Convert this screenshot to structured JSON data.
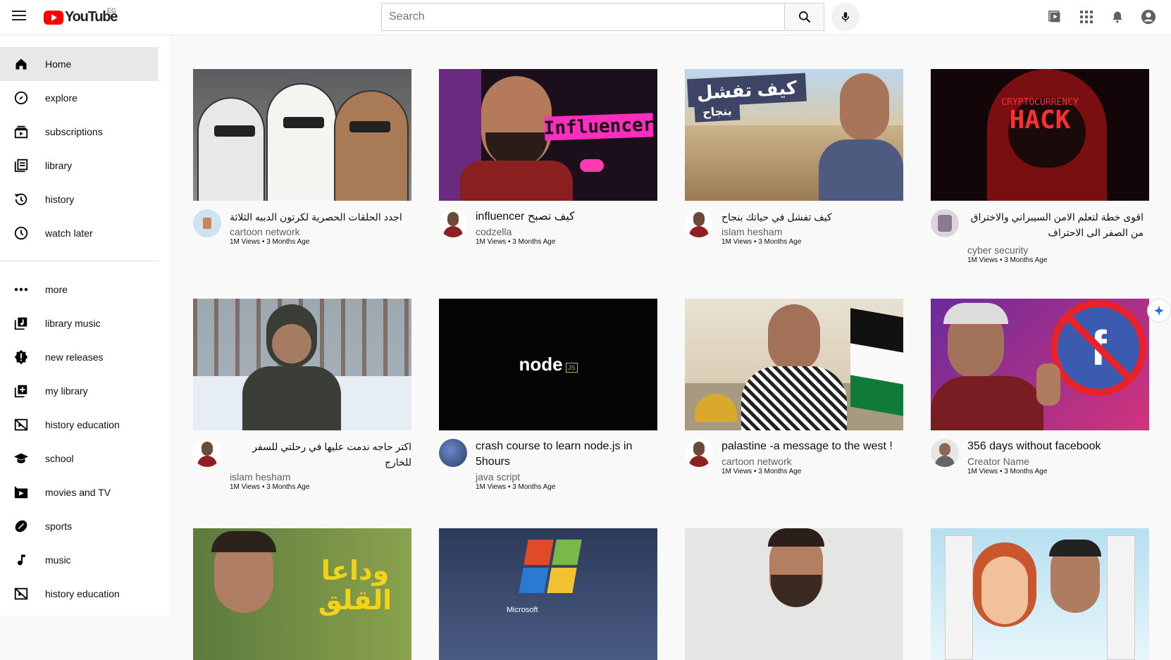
{
  "header": {
    "logo_text": "YouTube",
    "country_code": "EG",
    "search_placeholder": "Search"
  },
  "sidebar": {
    "items": [
      {
        "label": "Home",
        "icon": "home-icon"
      },
      {
        "label": "explore",
        "icon": "compass-icon"
      },
      {
        "label": "subscriptions",
        "icon": "subscriptions-icon"
      },
      {
        "label": "library",
        "icon": "library-icon"
      },
      {
        "label": "history",
        "icon": "history-icon"
      },
      {
        "label": "watch later",
        "icon": "clock-icon"
      },
      {
        "label": "more",
        "icon": "more-dots-icon"
      },
      {
        "label": "library music",
        "icon": "music-library-icon"
      },
      {
        "label": "new releases",
        "icon": "new-releases-icon"
      },
      {
        "label": "my library",
        "icon": "add-library-icon"
      },
      {
        "label": "history education",
        "icon": "education-icon"
      },
      {
        "label": "school",
        "icon": "school-icon"
      },
      {
        "label": "movies and TV",
        "icon": "movies-icon"
      },
      {
        "label": "sports",
        "icon": "sports-icon"
      },
      {
        "label": "music",
        "icon": "music-note-icon"
      },
      {
        "label": "history education",
        "icon": "education-icon"
      }
    ]
  },
  "videos": [
    {
      "title": "اجدد الحلقات الحصرية لكرتون الدببه الثلاثة",
      "channel": "cartoon network",
      "stats": "1M Views • 3 Months Age",
      "rtl": true
    },
    {
      "title": "كيف تصبح influencer",
      "channel": "codzella",
      "stats": "1M Views • 3 Months Age",
      "rtl": true
    },
    {
      "title": "كيف تفشل في حياتك بنجاح",
      "channel": "islam hesham",
      "stats": "1M Views • 3 Months Age",
      "rtl": true
    },
    {
      "title": "اقوى خطة لتعلم الامن السيبراني والاختراق من الصفر الى الاحتراف",
      "channel": "cyber security",
      "stats": "1M Views • 3 Months Age",
      "rtl": true
    },
    {
      "title": "اكتر حاجه ندمت عليها في رحلتي للسفر للخارج",
      "channel": "islam hesham",
      "stats": "1M Views • 3 Months Age",
      "rtl": true
    },
    {
      "title": "crash course to learn node.js in 5hours",
      "channel": "java script",
      "stats": "1M Views • 3 Months Age",
      "rtl": false
    },
    {
      "title": "palastine -a message to the west !",
      "channel": "cartoon network",
      "stats": "1M Views • 3 Months Age",
      "rtl": false
    },
    {
      "title": "356 days without facebook",
      "channel": "Creator Name",
      "stats": "1M Views • 3 Months Age",
      "rtl": false
    }
  ],
  "thumb_text": {
    "influencer": "Influencer",
    "fail_line1": "كيف تفشل",
    "fail_line2": "بنجاح",
    "crypto_line1": "CRYPTOCURRENCY",
    "crypto_line2": "HACK",
    "node": "node",
    "node_js": "JS",
    "farewell_line1": "وداعا",
    "farewell_line2": "القلق",
    "microsoft": "Microsoft"
  },
  "colors": {
    "brand_red": "#ff0000",
    "active_bg": "#e8e8e8"
  }
}
